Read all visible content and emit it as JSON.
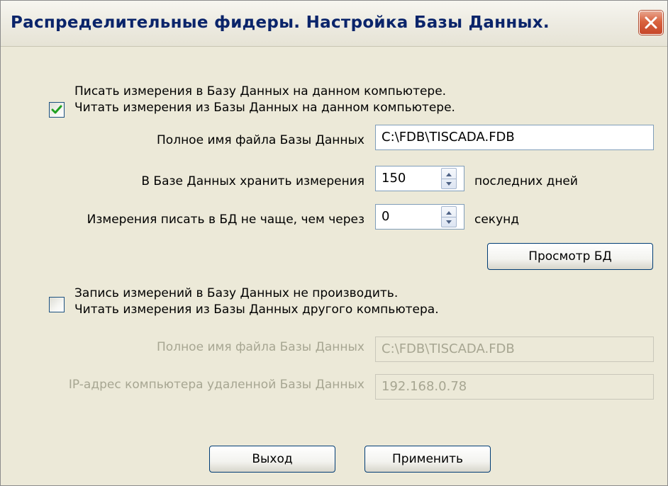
{
  "window": {
    "title": "Распределительные фидеры.  Настройка Базы Данных."
  },
  "local_db": {
    "checked": true,
    "label_line1": "Писать измерения в Базу Данных на данном компьютере.",
    "label_line2": "Читать измерения из Базы Данных на данном компьютере.",
    "filename_label": "Полное имя файла Базы Данных",
    "filename_value": "C:\\FDB\\TISCADA.FDB",
    "keep_label": "В Базе Данных хранить измерения",
    "keep_value": "150",
    "keep_suffix": "последних дней",
    "interval_label": "Измерения писать в БД не чаще, чем через",
    "interval_value": "0",
    "interval_suffix": "секунд",
    "view_button": "Просмотр БД"
  },
  "remote_db": {
    "checked": false,
    "label_line1": "Запись измерений в Базу Данных не производить.",
    "label_line2": "Читать измерения из Базы Данных другого компьютера.",
    "filename_label": "Полное имя файла Базы Данных",
    "filename_value": "C:\\FDB\\TISCADA.FDB",
    "ip_label": "IP-адрес компьютера удаленной Базы Данных",
    "ip_value": "192.168.0.78"
  },
  "footer": {
    "exit_button": "Выход",
    "apply_button": "Применить"
  },
  "icons": {
    "close": "close-x-icon",
    "check": "checkmark-icon",
    "spin_up": "arrow-up-icon",
    "spin_down": "arrow-down-icon"
  },
  "colors": {
    "title_text": "#0a246a",
    "close_button": "#d9633f",
    "window_bg": "#ece9d8",
    "check_mark": "#21a121",
    "disabled_text": "#a7a692"
  }
}
